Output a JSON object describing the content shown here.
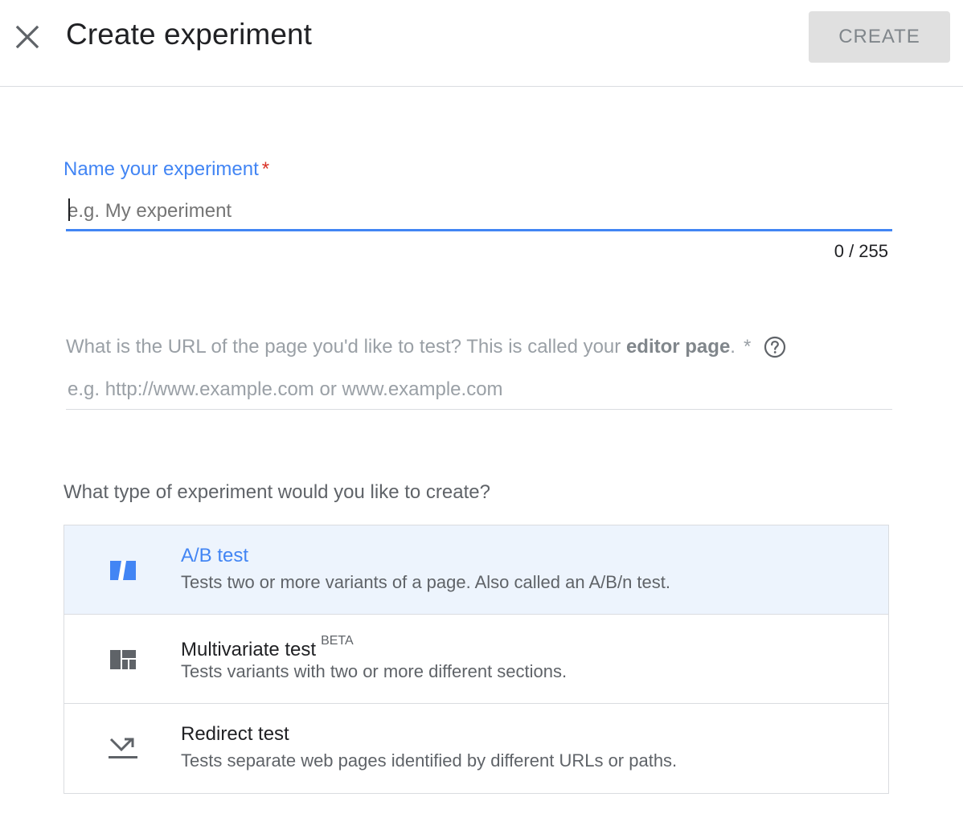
{
  "header": {
    "title": "Create experiment",
    "create_label": "CREATE"
  },
  "name_field": {
    "label": "Name your experiment",
    "required_mark": "*",
    "placeholder": "e.g. My experiment",
    "value": "",
    "counter": "0 / 255"
  },
  "url_field": {
    "label_prefix": "What is the URL of the page you'd like to test? This is called your ",
    "label_bold": "editor page",
    "label_suffix": ".",
    "required_mark": "*",
    "placeholder": "e.g. http://www.example.com or www.example.com",
    "value": ""
  },
  "experiment_type": {
    "question": "What type of experiment would you like to create?",
    "options": [
      {
        "title": "A/B test",
        "badge": "",
        "description": "Tests two or more variants of a page. Also called an A/B/n test.",
        "icon": "ab-test-icon",
        "selected": true
      },
      {
        "title": "Multivariate test",
        "badge": "BETA",
        "description": "Tests variants with two or more different sections.",
        "icon": "multivariate-icon",
        "selected": false
      },
      {
        "title": "Redirect test",
        "badge": "",
        "description": "Tests separate web pages identified by different URLs or paths.",
        "icon": "redirect-icon",
        "selected": false
      }
    ]
  },
  "colors": {
    "accent": "#4285f4",
    "required": "#d93025",
    "selected_bg": "#edf4fd"
  }
}
